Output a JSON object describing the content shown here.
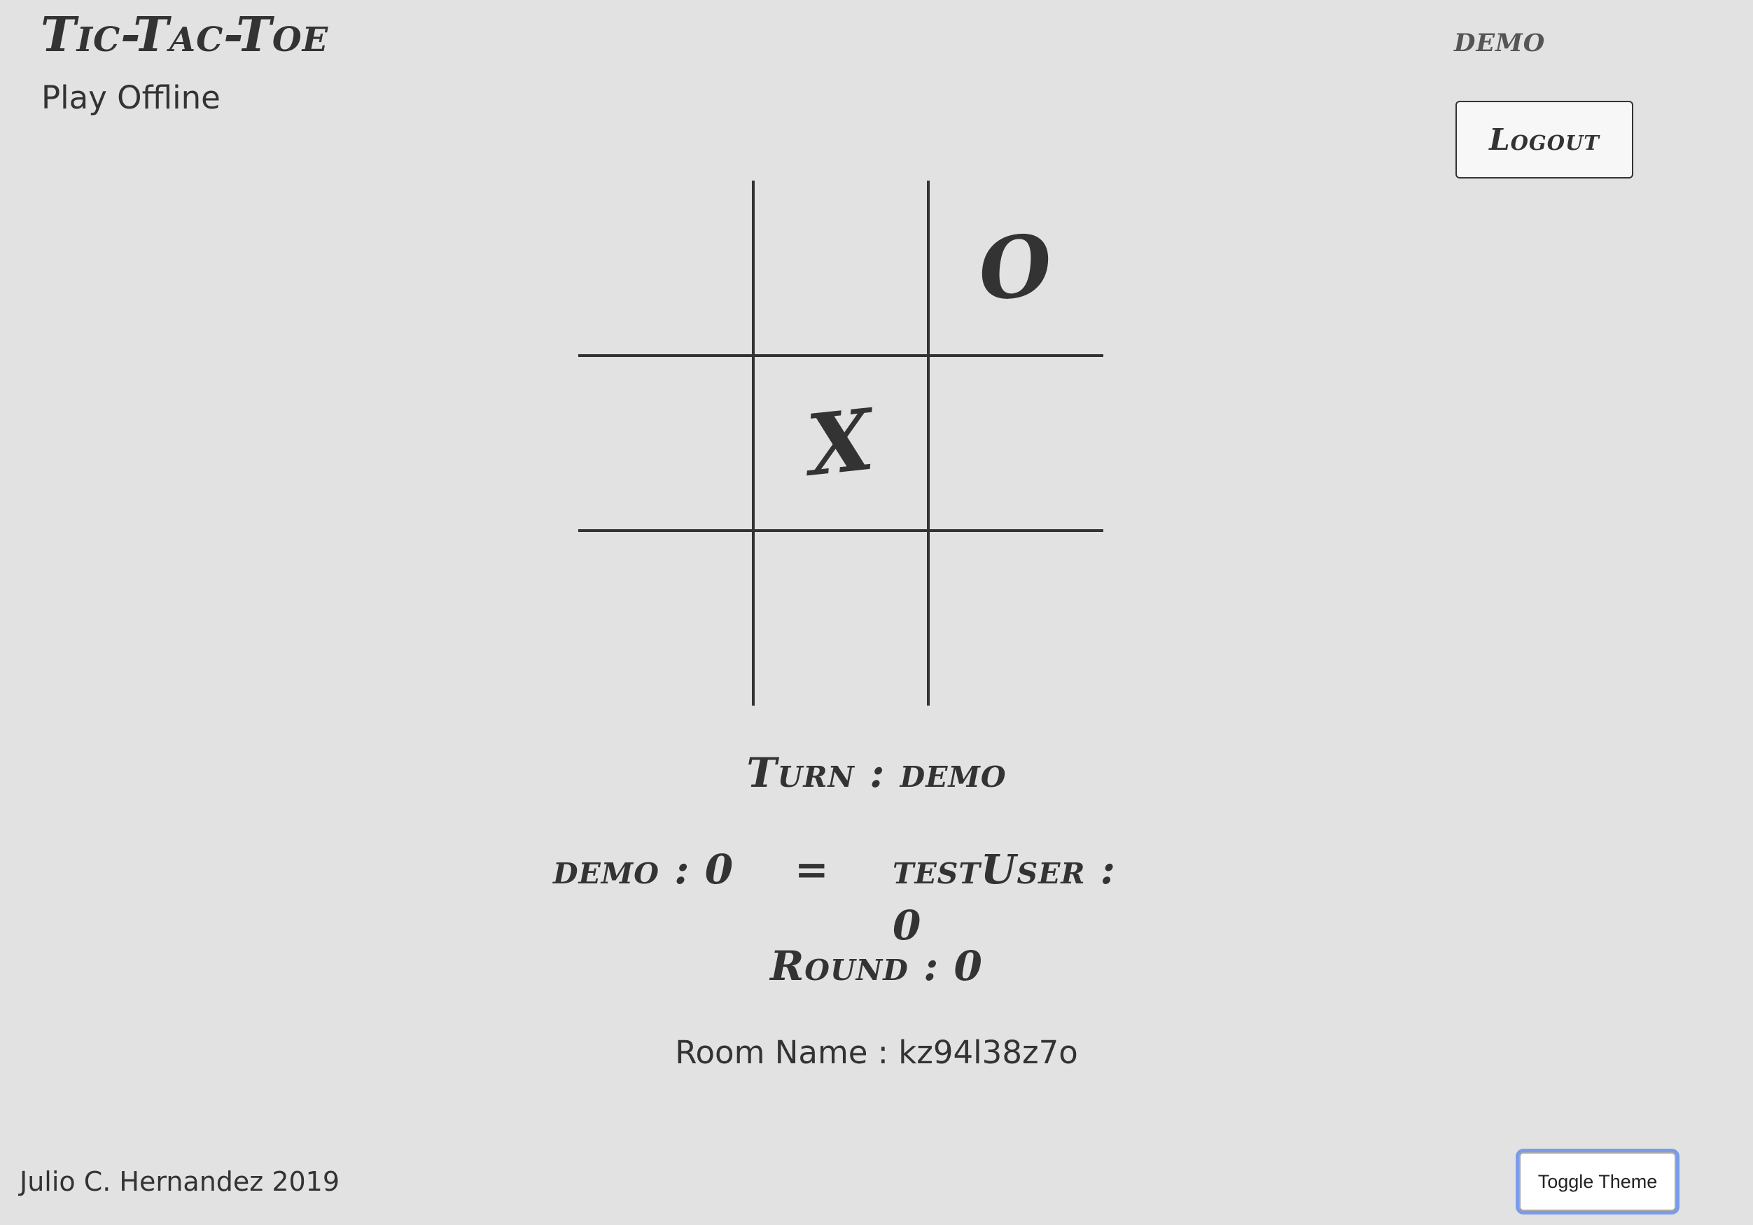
{
  "header": {
    "title": "Tic-Tac-Toe",
    "play_offline": "Play Offline",
    "username": "demo",
    "logout_label": "Logout"
  },
  "board": {
    "cells": [
      "",
      "",
      "O",
      "",
      "X",
      "",
      "",
      "",
      ""
    ]
  },
  "status": {
    "turn": "Turn : demo",
    "player1_score": "demo : 0",
    "separator": "=",
    "player2_score": "testUser : 0",
    "round": "Round : 0",
    "room": "Room Name : kz94l38z7o"
  },
  "footer": {
    "credit": "Julio C. Hernandez 2019",
    "toggle_theme_label": "Toggle Theme"
  }
}
